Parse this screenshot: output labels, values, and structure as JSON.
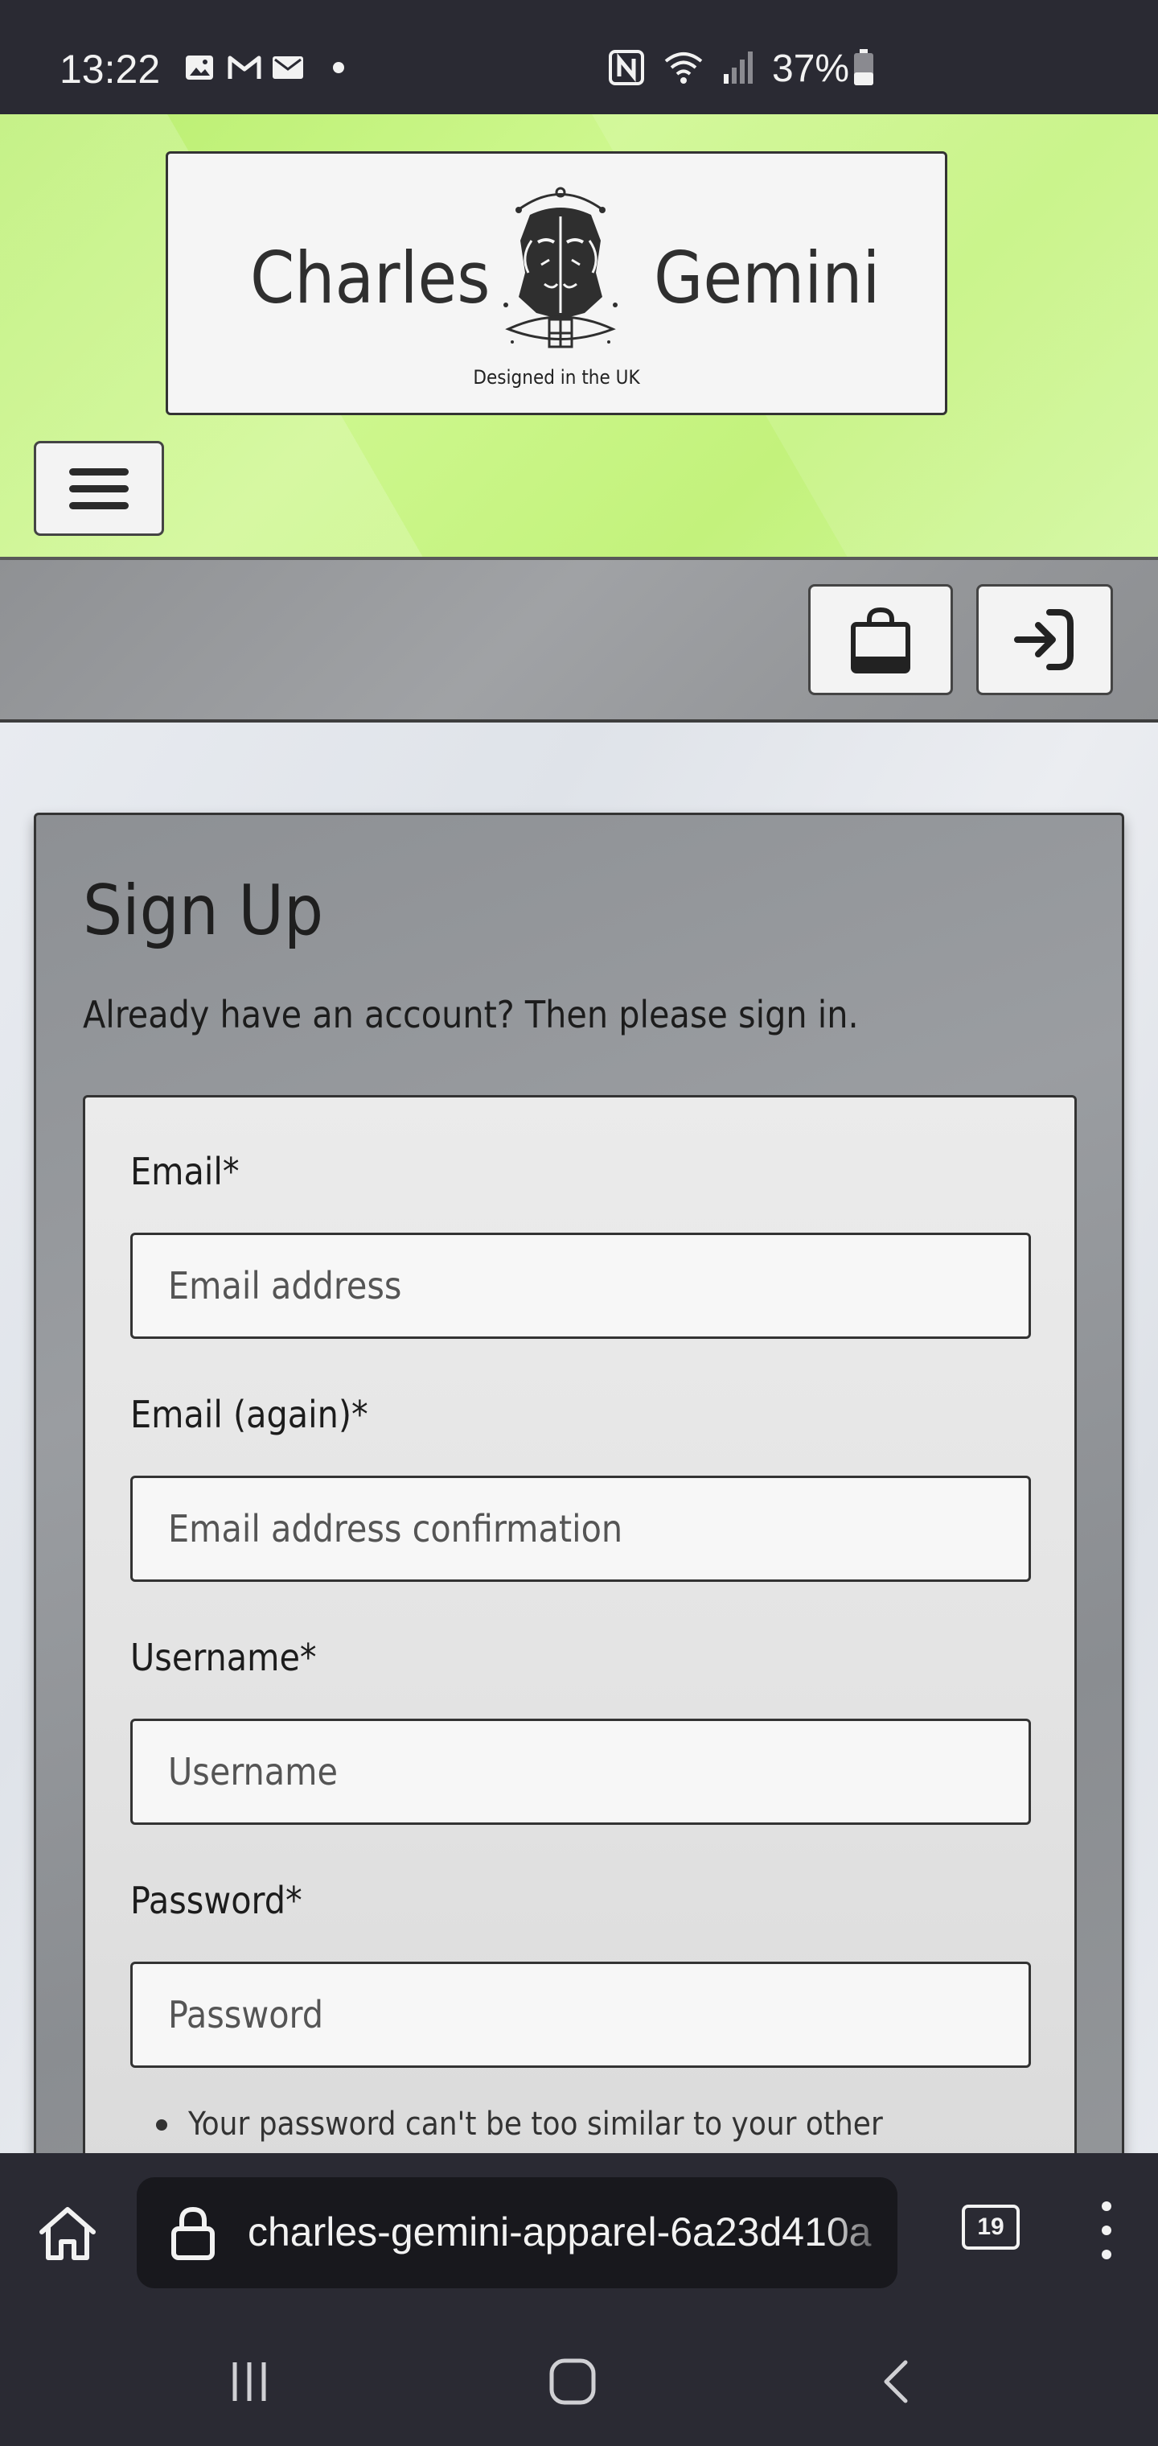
{
  "status_bar": {
    "time": "13:22",
    "battery_text": "37%",
    "icons": [
      "gallery-icon",
      "gmail-icon",
      "mail-icon",
      "notification-dot",
      "nfc-icon",
      "wifi-icon",
      "signal-icon",
      "battery-icon"
    ]
  },
  "header": {
    "brand_left": "Charles",
    "brand_right": "Gemini",
    "tagline": "Designed in the UK",
    "colors": {
      "header_bg": "#c6f47f",
      "toolbar_bg": "#96989b"
    }
  },
  "toolbar": {
    "icons": [
      "shopping-bag-icon",
      "login-icon"
    ]
  },
  "signup": {
    "title": "Sign Up",
    "subtitle_prefix": "Already have an account? Then please ",
    "subtitle_link": "sign in",
    "subtitle_suffix": ".",
    "fields": [
      {
        "label": "Email*",
        "placeholder": "Email address"
      },
      {
        "label": "Email (again)*",
        "placeholder": "Email address confirmation"
      },
      {
        "label": "Username*",
        "placeholder": "Username"
      },
      {
        "label": "Password*",
        "placeholder": "Password"
      }
    ],
    "password_help": "Your password can't be too similar to your other"
  },
  "browser": {
    "url": "charles-gemini-apparel-6a23d410a",
    "tab_count": "19"
  }
}
